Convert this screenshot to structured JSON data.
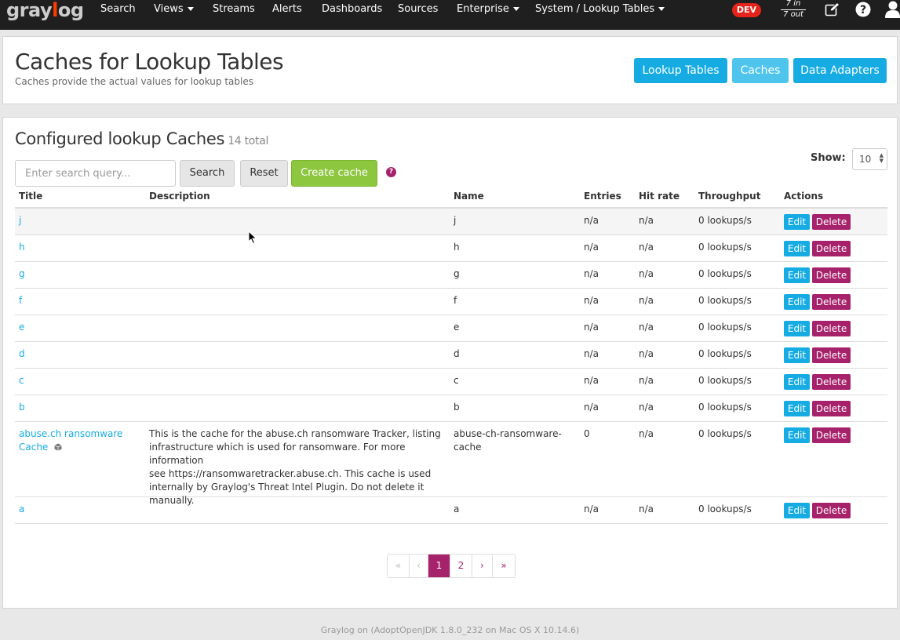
{
  "navbar": {
    "brand_prefix": "gray",
    "brand_o": "l",
    "brand_suffix": "og",
    "items": [
      {
        "label": "Search",
        "dropdown": false
      },
      {
        "label": "Views",
        "dropdown": true
      },
      {
        "label": "Streams",
        "dropdown": false
      },
      {
        "label": "Alerts",
        "dropdown": false
      },
      {
        "label": "Dashboards",
        "dropdown": false
      },
      {
        "label": "Sources",
        "dropdown": false
      },
      {
        "label": "Enterprise",
        "dropdown": true
      },
      {
        "label": "System / Lookup Tables",
        "dropdown": true
      }
    ],
    "dev_badge": "DEV",
    "throughput_in": "7 in",
    "throughput_out": "7 out",
    "icons": [
      "edit-icon",
      "help-icon",
      "user-icon"
    ]
  },
  "header": {
    "title": "Caches for Lookup Tables",
    "subtitle": "Caches provide the actual values for lookup tables",
    "buttons": [
      "Lookup Tables",
      "Caches",
      "Data Adapters"
    ],
    "active_button": "Caches"
  },
  "main": {
    "title": "Configured lookup Caches",
    "count": "14 total",
    "search_placeholder": "Enter search query...",
    "search_label": "Search",
    "reset_label": "Reset",
    "create_label": "Create cache",
    "show_label": "Show:",
    "show_value": "10",
    "columns": [
      "Title",
      "Description",
      "Name",
      "Entries",
      "Hit rate",
      "Throughput",
      "Actions"
    ],
    "edit_label": "Edit",
    "delete_label": "Delete",
    "rows": [
      {
        "title": "j",
        "description": "",
        "name": "j",
        "entries": "n/a",
        "hit_rate": "n/a",
        "throughput": "0 lookups/s"
      },
      {
        "title": "h",
        "description": "",
        "name": "h",
        "entries": "n/a",
        "hit_rate": "n/a",
        "throughput": "0 lookups/s"
      },
      {
        "title": "g",
        "description": "",
        "name": "g",
        "entries": "n/a",
        "hit_rate": "n/a",
        "throughput": "0 lookups/s"
      },
      {
        "title": "f",
        "description": "",
        "name": "f",
        "entries": "n/a",
        "hit_rate": "n/a",
        "throughput": "0 lookups/s"
      },
      {
        "title": "e",
        "description": "",
        "name": "e",
        "entries": "n/a",
        "hit_rate": "n/a",
        "throughput": "0 lookups/s"
      },
      {
        "title": "d",
        "description": "",
        "name": "d",
        "entries": "n/a",
        "hit_rate": "n/a",
        "throughput": "0 lookups/s"
      },
      {
        "title": "c",
        "description": "",
        "name": "c",
        "entries": "n/a",
        "hit_rate": "n/a",
        "throughput": "0 lookups/s"
      },
      {
        "title": "b",
        "description": "",
        "name": "b",
        "entries": "n/a",
        "hit_rate": "n/a",
        "throughput": "0 lookups/s"
      },
      {
        "title_line1": "abuse.ch ransomware",
        "title_line2": "Cache",
        "content_pack": true,
        "description_lines": [
          "This is the cache for the abuse.ch ransomware Tracker, listing",
          "infrastructure which is used for ransomware. For more information",
          "see https://ransomwaretracker.abuse.ch. This cache is used",
          "internally by Graylog's Threat Intel Plugin. Do not delete it",
          "manually."
        ],
        "name_line1": "abuse-ch-ransomware-",
        "name_line2": "cache",
        "entries": "0",
        "hit_rate": "n/a",
        "throughput": "0 lookups/s"
      },
      {
        "title": "a",
        "description": "",
        "name": "a",
        "entries": "n/a",
        "hit_rate": "n/a",
        "throughput": "0 lookups/s"
      }
    ],
    "pagination": [
      "«",
      "‹",
      "1",
      "2",
      "›",
      "»"
    ],
    "current_page": "1"
  },
  "footer": {
    "text": "Graylog on (AdoptOpenJDK 1.8.0_232 on Mac OS X 10.14.6)"
  },
  "colors": {
    "navbar_bg": "#1f1f1f",
    "primary": "#16ace3",
    "danger": "#a6226b",
    "success": "#8dc63f",
    "dev_badge": "#e5231b"
  }
}
